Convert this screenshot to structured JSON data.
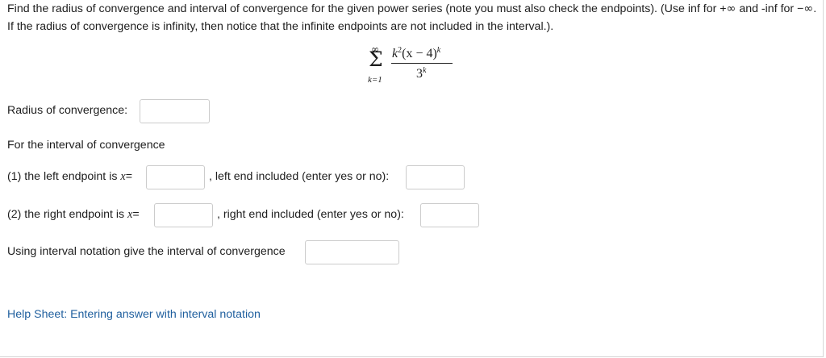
{
  "prompt": {
    "part1": "Find the radius of convergence and interval of convergence for the given power series (note you must also check the endpoints). (Use inf for +",
    "inf_symbol": "∞",
    "part2": " and -inf for −",
    "part3": ". If the radius of convergence is infinity, then notice that the infinite endpoints are not included in the interval.)."
  },
  "formula": {
    "sum_top": "∞",
    "sum_symbol": "Σ",
    "sum_bottom": "k=1",
    "num_k": "k",
    "num_exp2": "2",
    "num_mid": "(x − 4)",
    "num_expk": "k",
    "den_base": "3",
    "den_exp": "k"
  },
  "radius": {
    "label": "Radius of convergence:",
    "value": ""
  },
  "interval_heading": "For the interval of convergence",
  "left_endpoint": {
    "label_prefix": "(1) the left endpoint is ",
    "var": "x",
    "eq": "=",
    "value": "",
    "included_label": ", left end included (enter yes or no):",
    "included_value": ""
  },
  "right_endpoint": {
    "label_prefix": "(2) the right endpoint is ",
    "var": "x",
    "eq": "=",
    "value": "",
    "included_label": ", right end included (enter yes or no):",
    "included_value": ""
  },
  "interval_notation": {
    "label": "Using interval notation give the interval of convergence",
    "value": ""
  },
  "help_link": "Help Sheet: Entering answer with interval notation",
  "colors": {
    "link": "#1f5f9e",
    "border": "#cccccc",
    "text": "#1e1e1e"
  }
}
